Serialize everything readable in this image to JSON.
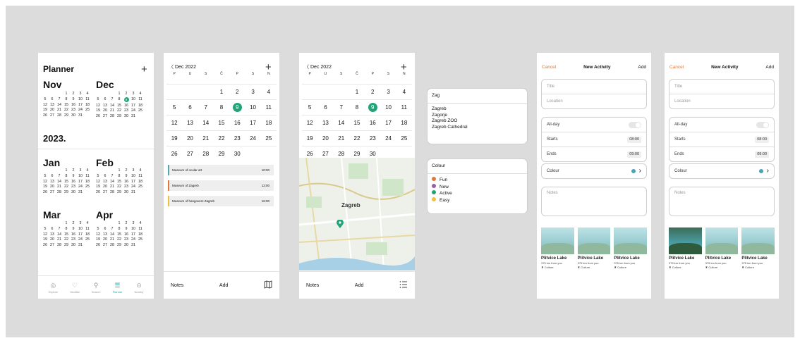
{
  "planner": {
    "title": "Planner",
    "plus": "+",
    "months_2022": [
      {
        "name": "Nov",
        "weeks": [
          [
            "",
            "",
            "",
            "1",
            "2",
            "3",
            "4"
          ],
          [
            "5",
            "6",
            "7",
            "8",
            "9",
            "10",
            "11"
          ],
          [
            "12",
            "13",
            "14",
            "15",
            "16",
            "17",
            "18"
          ],
          [
            "19",
            "20",
            "21",
            "22",
            "23",
            "24",
            "25"
          ],
          [
            "26",
            "27",
            "28",
            "29",
            "30",
            "31",
            ""
          ]
        ]
      },
      {
        "name": "Dec",
        "weeks": [
          [
            "",
            "",
            "",
            "1",
            "2",
            "3",
            "4"
          ],
          [
            "5",
            "6",
            "7",
            "8",
            "9",
            "10",
            "11"
          ],
          [
            "12",
            "13",
            "14",
            "15",
            "16",
            "17",
            "18"
          ],
          [
            "19",
            "20",
            "21",
            "22",
            "23",
            "24",
            "25"
          ],
          [
            "26",
            "27",
            "28",
            "29",
            "30",
            "31",
            ""
          ]
        ]
      }
    ],
    "year": "2023.",
    "months_2023": [
      {
        "name": "Jan",
        "weeks": [
          [
            "",
            "",
            "",
            "1",
            "2",
            "3",
            "4"
          ],
          [
            "5",
            "6",
            "7",
            "8",
            "9",
            "10",
            "11"
          ],
          [
            "12",
            "13",
            "14",
            "15",
            "16",
            "17",
            "18"
          ],
          [
            "19",
            "20",
            "21",
            "22",
            "23",
            "24",
            "25"
          ],
          [
            "26",
            "27",
            "28",
            "29",
            "30",
            "31",
            ""
          ]
        ]
      },
      {
        "name": "Feb",
        "weeks": [
          [
            "",
            "",
            "",
            "1",
            "2",
            "3",
            "4"
          ],
          [
            "5",
            "6",
            "7",
            "8",
            "9",
            "10",
            "11"
          ],
          [
            "12",
            "13",
            "14",
            "15",
            "16",
            "17",
            "18"
          ],
          [
            "19",
            "20",
            "21",
            "22",
            "23",
            "24",
            "25"
          ],
          [
            "26",
            "27",
            "28",
            "29",
            "30",
            "31",
            ""
          ]
        ]
      },
      {
        "name": "Mar",
        "weeks": [
          [
            "",
            "",
            "",
            "1",
            "2",
            "3",
            "4"
          ],
          [
            "5",
            "6",
            "7",
            "8",
            "9",
            "10",
            "11"
          ],
          [
            "12",
            "13",
            "14",
            "15",
            "16",
            "17",
            "18"
          ],
          [
            "19",
            "20",
            "21",
            "22",
            "23",
            "24",
            "25"
          ],
          [
            "26",
            "27",
            "28",
            "29",
            "30",
            "31",
            ""
          ]
        ]
      },
      {
        "name": "Apr",
        "weeks": [
          [
            "",
            "",
            "",
            "1",
            "2",
            "3",
            "4"
          ],
          [
            "5",
            "6",
            "7",
            "8",
            "9",
            "10",
            "11"
          ],
          [
            "12",
            "13",
            "14",
            "15",
            "16",
            "17",
            "18"
          ],
          [
            "19",
            "20",
            "21",
            "22",
            "23",
            "24",
            "25"
          ],
          [
            "26",
            "27",
            "28",
            "29",
            "30",
            "31",
            ""
          ]
        ]
      }
    ],
    "tabs": [
      {
        "label": "Explore",
        "icon": "compass-icon",
        "glyph": "◎"
      },
      {
        "label": "Heatlist",
        "icon": "heart-icon",
        "glyph": "♡"
      },
      {
        "label": "Search",
        "icon": "search-icon",
        "glyph": "⚲"
      },
      {
        "label": "Planner",
        "icon": "planner-icon",
        "glyph": "☰",
        "active": true
      },
      {
        "label": "Nearby",
        "icon": "location-icon",
        "glyph": "⊙"
      }
    ]
  },
  "calendar": {
    "back": "〈",
    "month": "Dec 2022",
    "plus": "+",
    "weekdays": [
      "P",
      "U",
      "S",
      "Č",
      "P",
      "S",
      "N"
    ],
    "weeks": [
      [
        "",
        "",
        "",
        "1",
        "2",
        "3",
        "4"
      ],
      [
        "5",
        "6",
        "7",
        "8",
        "9",
        "10",
        "11"
      ],
      [
        "12",
        "13",
        "14",
        "15",
        "16",
        "17",
        "18"
      ],
      [
        "19",
        "20",
        "21",
        "22",
        "23",
        "24",
        "25"
      ],
      [
        "26",
        "27",
        "28",
        "29",
        "30",
        "",
        ""
      ]
    ],
    "today": "9",
    "events": [
      {
        "name": "Museum of ocular art",
        "time": "10:00",
        "color": "#5aa6b0"
      },
      {
        "name": "Museum of Zagreb",
        "time": "12:00",
        "color": "#e07a3a"
      },
      {
        "name": "Museum of hangovers Zagreb",
        "time": "16:00",
        "color": "#f0c040"
      }
    ],
    "notes": "Notes",
    "add": "Add",
    "map_icon": "map-icon"
  },
  "map_screen": {
    "back": "〈",
    "month": "Dec 2022",
    "plus": "+",
    "city": "Zagreb",
    "notes": "Notes",
    "add": "Add",
    "list_icon": "list-icon",
    "pin_color": "#24a37a"
  },
  "search_popup": {
    "query": "Zag",
    "results": [
      "Zagreb",
      "Zagorje",
      "Zagreb ZOO",
      "Zagreb Cathedral"
    ]
  },
  "colour_popup": {
    "title": "Colour",
    "options": [
      {
        "label": "Fun",
        "color": "#e07a3a"
      },
      {
        "label": "New",
        "color": "#9b5fa5"
      },
      {
        "label": "Active",
        "color": "#24a37a"
      },
      {
        "label": "Easy",
        "color": "#f0c040"
      }
    ]
  },
  "new_activity": {
    "cancel": "Cancel",
    "title": "New Activity",
    "add": "Add",
    "title_placeholder": "Title",
    "location_placeholder": "Location",
    "allday": "All-day",
    "starts": "Starts",
    "starts_time": "08:00",
    "ends": "Ends",
    "ends_time": "09:00",
    "colour": "Colour",
    "colour_value": "#4aa3b8",
    "notes_placeholder": "Notes",
    "places": [
      {
        "name": "Plitvice Lake",
        "distance": "375 km from you",
        "tag": "Culture"
      },
      {
        "name": "Plitvice Lake",
        "distance": "375 km from you",
        "tag": "Culture"
      },
      {
        "name": "Plitvice Lake",
        "distance": "375 km from you",
        "tag": "Culture"
      }
    ]
  }
}
